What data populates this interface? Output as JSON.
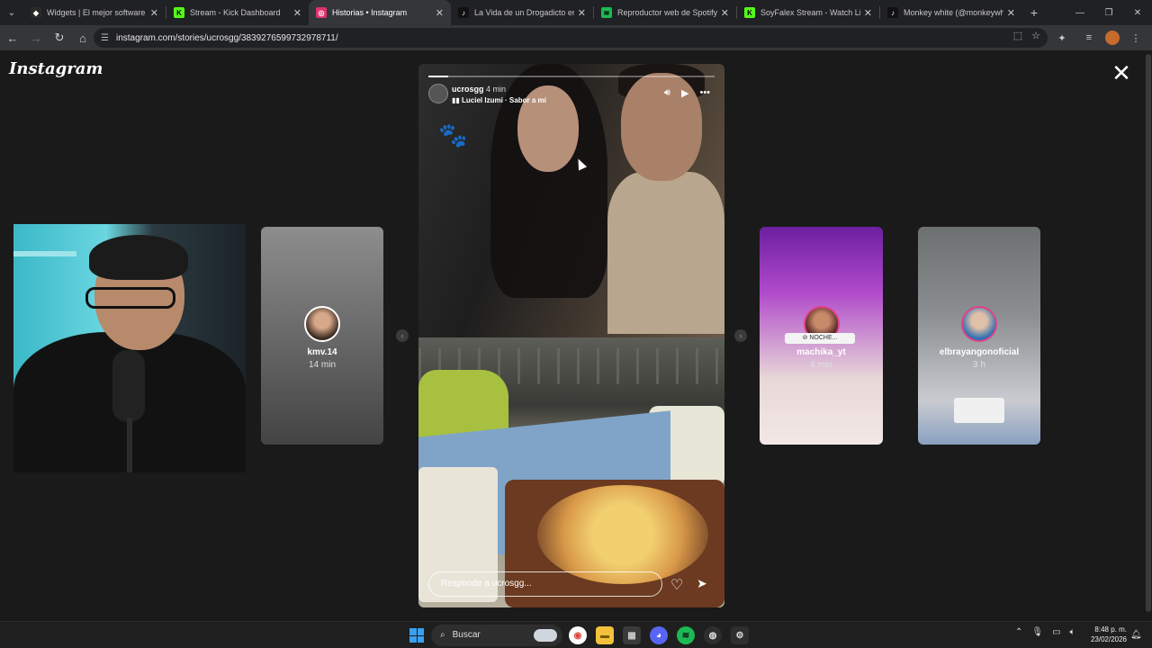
{
  "browser": {
    "tabs": [
      {
        "title": "Widgets | El mejor software pa",
        "favicon": "widgets-icon",
        "active": false
      },
      {
        "title": "Stream - Kick Dashboard",
        "favicon": "kick-icon",
        "active": false
      },
      {
        "title": "Historias • Instagram",
        "favicon": "instagram-icon",
        "active": true
      },
      {
        "title": "La Vida de un Drogadicto en C",
        "favicon": "tiktok-icon",
        "active": false
      },
      {
        "title": "Reproductor web de Spotify: m",
        "favicon": "spotify-icon",
        "active": false
      },
      {
        "title": "SoyFalex Stream - Watch Live o",
        "favicon": "kick-icon",
        "active": false
      },
      {
        "title": "Monkey white (@monkeywhite",
        "favicon": "tiktok-icon",
        "active": false
      }
    ],
    "new_tab": "+",
    "url": "instagram.com/stories/ucrosgg/3839276599732978711/",
    "window_controls": [
      "minimize-icon",
      "restore-icon",
      "close-icon"
    ]
  },
  "page": {
    "logo": "Instagram",
    "close": "✕",
    "side_stories_left": [
      {
        "name": "kmv.14",
        "time": "14 min"
      }
    ],
    "side_stories_right": [
      {
        "name": "machika_yt",
        "time": "6 min",
        "tag": "⊘ NOCHE..."
      },
      {
        "name": "elbrayangonoficial",
        "time": "3 h"
      }
    ],
    "story": {
      "user": "ucrosgg",
      "time": "4 min",
      "music": "Luciel Izumi · Sabor a mí",
      "progress": 0.07,
      "reply_placeholder": "Responde a ucrosgg..."
    },
    "nav_prev": "‹",
    "nav_next": "›"
  },
  "taskbar": {
    "search": "Buscar",
    "time": "8:48 p. m.",
    "date": "23/02/2026"
  }
}
